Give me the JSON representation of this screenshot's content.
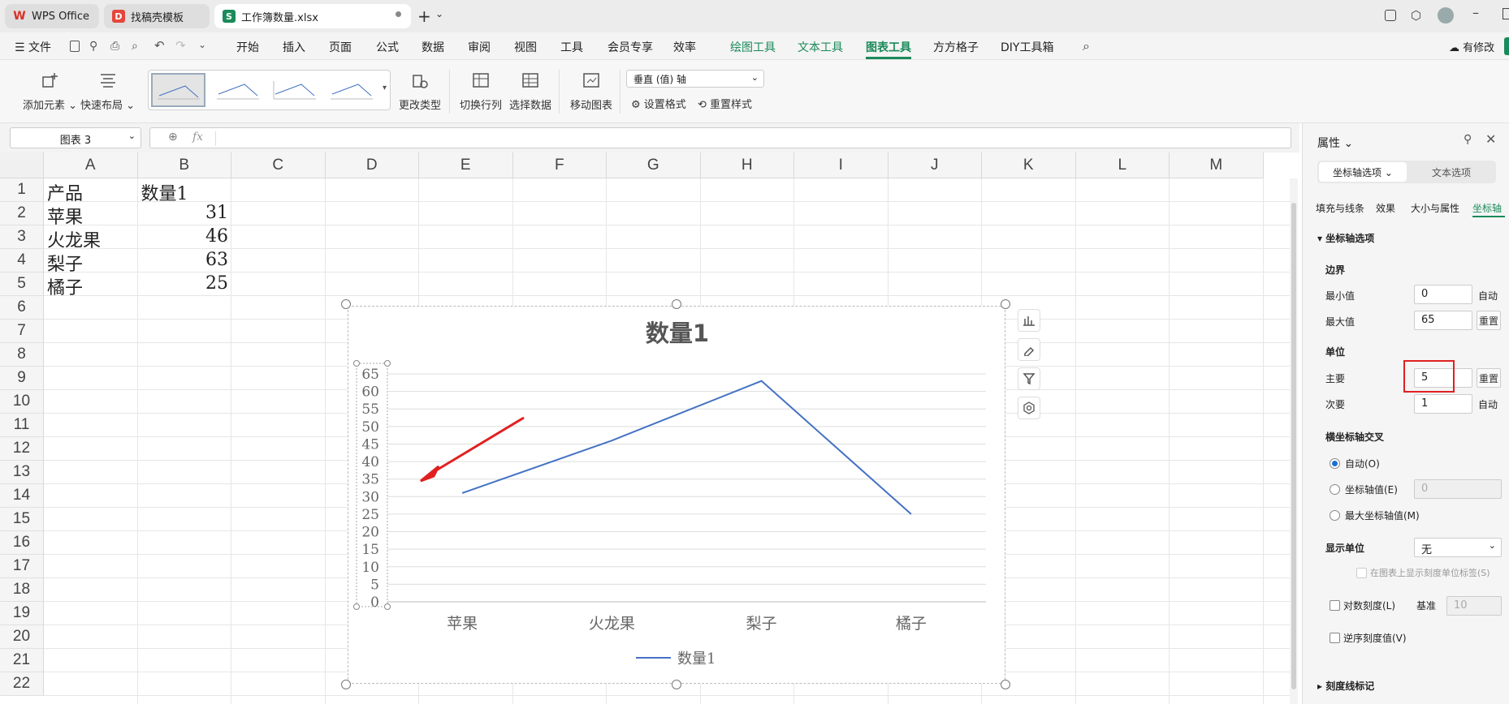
{
  "tabs": [
    {
      "label": "WPS Office",
      "icon": "wps-logo-icon"
    },
    {
      "label": "找稿壳模板",
      "icon": "docer-icon"
    },
    {
      "label": "工作簿数量.xlsx",
      "icon": "sheet-s-icon"
    }
  ],
  "menu": {
    "file": "文件",
    "items": [
      "开始",
      "插入",
      "页面",
      "公式",
      "数据",
      "审阅",
      "视图",
      "工具",
      "会员专享",
      "效率"
    ],
    "context": [
      "绘图工具",
      "文本工具",
      "图表工具",
      "方方格子",
      "DIY工具箱"
    ],
    "active": "图表工具",
    "edit": "有修改"
  },
  "ribbon": {
    "add_element": "添加元素",
    "quick_layout": "快速布局",
    "change_type": "更改类型",
    "switch_rowcol": "切换行列",
    "select_data": "选择数据",
    "move_chart": "移动图表",
    "element_select": "垂直 (值) 轴",
    "format": "设置格式",
    "reset_style": "重置样式"
  },
  "formula_bar": {
    "name_box": "图表 3",
    "fx": "fx",
    "value": ""
  },
  "sheet": {
    "columns": [
      "A",
      "B",
      "C",
      "D",
      "E",
      "F",
      "G",
      "H",
      "I",
      "J",
      "K",
      "L",
      "M"
    ],
    "rows": [
      "1",
      "2",
      "3",
      "4",
      "5",
      "6",
      "7",
      "8",
      "9",
      "10",
      "11",
      "12",
      "13",
      "14",
      "15",
      "16",
      "17",
      "18",
      "19",
      "20",
      "21",
      "22"
    ],
    "header": {
      "a": "产品",
      "b": "数量1"
    },
    "data": [
      {
        "a": "苹果",
        "b": "31"
      },
      {
        "a": "火龙果",
        "b": "46"
      },
      {
        "a": "梨子",
        "b": "63"
      },
      {
        "a": "橘子",
        "b": "25"
      }
    ]
  },
  "chart_data": {
    "type": "line",
    "title": "数量1",
    "categories": [
      "苹果",
      "火龙果",
      "梨子",
      "橘子"
    ],
    "series": [
      {
        "name": "数量1",
        "values": [
          31,
          46,
          63,
          25
        ],
        "color": "#4472c4"
      }
    ],
    "ylim": [
      0,
      65
    ],
    "ytick_step": 5,
    "yticks": [
      "0",
      "5",
      "10",
      "15",
      "20",
      "25",
      "30",
      "35",
      "40",
      "45",
      "50",
      "55",
      "60",
      "65"
    ],
    "grid": true,
    "legend": "bottom"
  },
  "panel": {
    "title": "属性",
    "tab_axis": "坐标轴选项",
    "tab_text": "文本选项",
    "subtabs": [
      "填充与线条",
      "效果",
      "大小与属性",
      "坐标轴"
    ],
    "section": "坐标轴选项",
    "bounds_label": "边界",
    "min_label": "最小值",
    "min_value": "0",
    "min_btn": "自动",
    "max_label": "最大值",
    "max_value": "65",
    "max_btn": "重置",
    "units_label": "单位",
    "major_label": "主要",
    "major_value": "5",
    "major_btn": "重置",
    "minor_label": "次要",
    "minor_value": "1",
    "minor_btn": "自动",
    "cross_label": "横坐标轴交叉",
    "cross_auto": "自动(O)",
    "cross_value": "坐标轴值(E)",
    "cross_value_input": "0",
    "cross_max": "最大坐标轴值(M)",
    "display_units_label": "显示单位",
    "display_units_value": "无",
    "show_units_label": "在图表上显示刻度单位标签(S)",
    "log_scale": "对数刻度(L)",
    "base_label": "基准",
    "base_value": "10",
    "reverse": "逆序刻度值(V)",
    "tick_marks": "刻度线标记"
  },
  "colors": {
    "accent": "#1a8a5a",
    "series": "#4472c4",
    "highlight": "#e02020"
  }
}
